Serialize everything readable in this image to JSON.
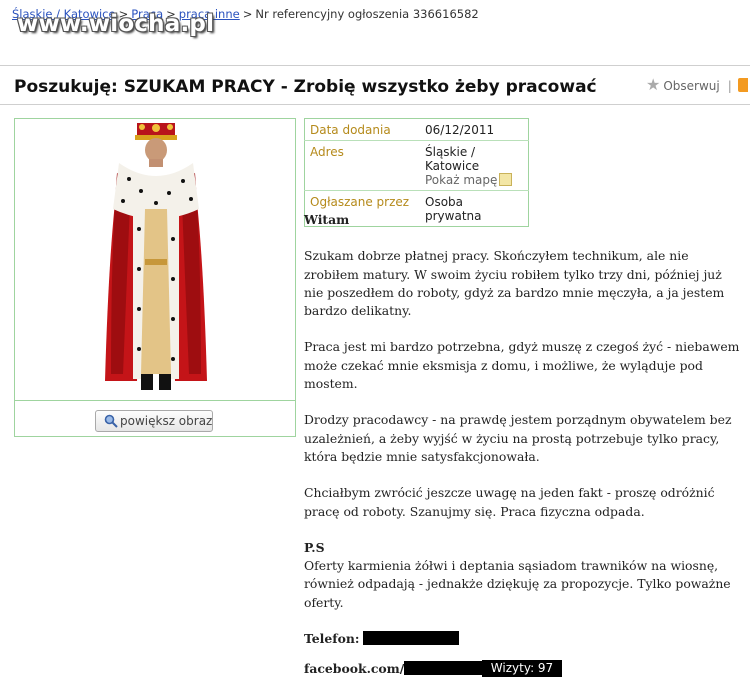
{
  "breadcrumb": {
    "items": [
      "Śląskie / Katowice",
      "Praca",
      "praca inne"
    ],
    "current": "Nr referencyjny ogłoszenia 336616582"
  },
  "watermark": "www.wiocha.pl",
  "listing": {
    "title": "Poszukuję: SZUKAM PRACY - Zrobię wszystko żeby pracować",
    "observe_label": "Obserwuj",
    "enlarge_label": "powiększ obraz"
  },
  "info": {
    "date_label": "Data dodania",
    "date_value": "06/12/2011",
    "address_label": "Adres",
    "address_value": "Śląskie / Katowice",
    "map_link": "Pokaż mapę",
    "posted_by_label": "Ogłaszane przez",
    "posted_by_value": "Osoba prywatna"
  },
  "description": {
    "greeting": "Witam",
    "p1": "Szukam dobrze płatnej pracy. Skończyłem technikum, ale nie zrobiłem matury. W swoim życiu robiłem tylko trzy dni, później już nie poszedłem do roboty, gdyż za bardzo mnie męczyła, a ja jestem bardzo delikatny.",
    "p2": "Praca jest mi bardzo potrzebna, gdyż muszę z czegoś żyć - niebawem może czekać mnie eksmisja z domu, i możliwe, że wyląduje pod mostem.",
    "p3": "Drodzy pracodawcy - na prawdę jestem porządnym obywatelem bez uzależnień, a żeby wyjść w życiu na prostą potrzebuje tylko pracy, która będzie mnie satysfakcjonowała.",
    "p4": "Chciałbym zwrócić jeszcze uwagę na jeden fakt - proszę odróżnić pracę od roboty. Szanujmy się. Praca fizyczna odpada.",
    "ps_label": "P.S",
    "ps_text": "Oferty karmienia żółwi i deptania sąsiadom trawników na wiosnę, również odpadają - jednakże dziękuję za propozycje. Tylko poważne oferty.",
    "phone_label": "Telefon:",
    "facebook_label": "facebook.com/"
  },
  "visits": "Wizyty: 97"
}
